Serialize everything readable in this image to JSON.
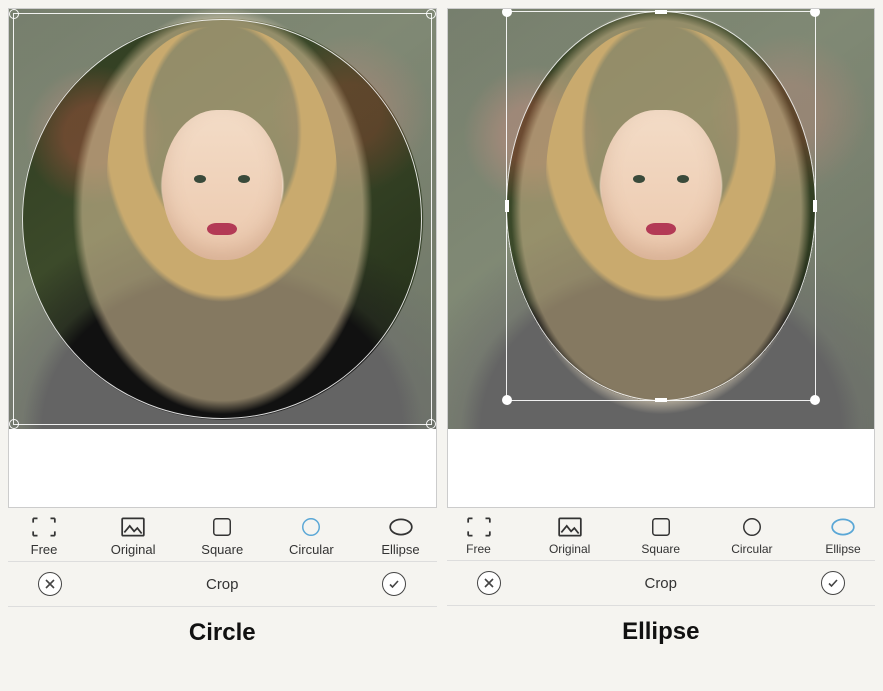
{
  "panels": [
    {
      "caption": "Circle",
      "selected_option": "circular",
      "crop_shape": "circle"
    },
    {
      "caption": "Ellipse",
      "selected_option": "ellipse",
      "crop_shape": "ellipse"
    }
  ],
  "options": {
    "free": "Free",
    "original": "Original",
    "square": "Square",
    "circular": "Circular",
    "ellipse": "Ellipse"
  },
  "crop_row": {
    "label": "Crop"
  }
}
